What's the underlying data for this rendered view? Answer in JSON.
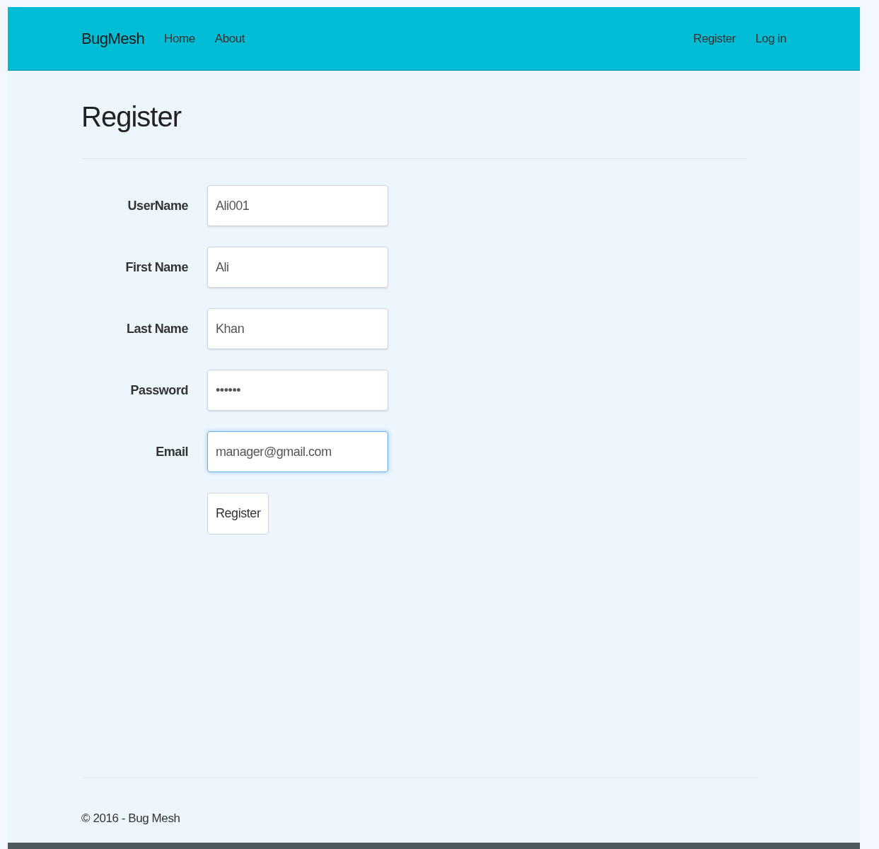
{
  "navbar": {
    "brand": "BugMesh",
    "left_links": [
      {
        "label": "Home"
      },
      {
        "label": "About"
      }
    ],
    "right_links": [
      {
        "label": "Register"
      },
      {
        "label": "Log in"
      }
    ]
  },
  "heading": "Register",
  "form": {
    "fields": [
      {
        "label": "UserName",
        "value": "Ali001",
        "focused": false
      },
      {
        "label": "First Name",
        "value": "Ali",
        "focused": false
      },
      {
        "label": "Last Name",
        "value": "Khan",
        "focused": false
      },
      {
        "label": "Password",
        "value": "••••••",
        "focused": false
      },
      {
        "label": "Email",
        "value": "manager@gmail.com",
        "focused": true
      }
    ],
    "submit": "Register"
  },
  "footer": "© 2016 - Bug Mesh"
}
